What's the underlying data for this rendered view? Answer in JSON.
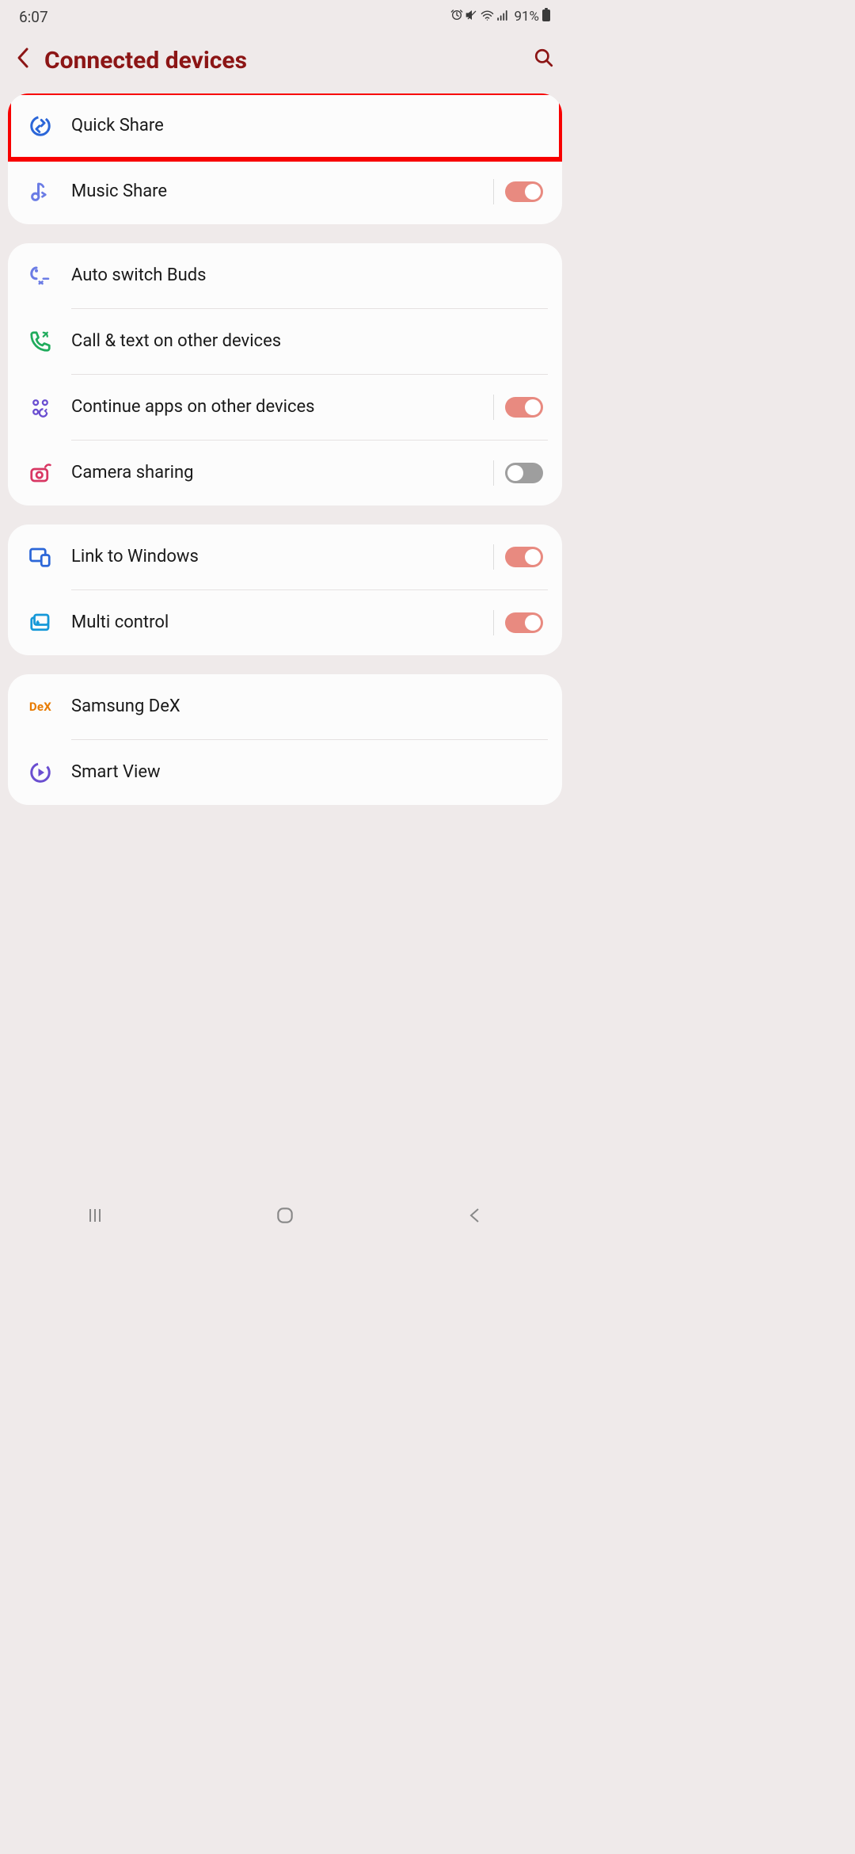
{
  "status": {
    "time": "6:07",
    "battery": "91%"
  },
  "header": {
    "title": "Connected devices"
  },
  "groups": [
    {
      "items": [
        {
          "id": "quick-share",
          "label": "Quick Share",
          "icon": "quick-share-icon",
          "icon_color": "#2b66d8",
          "highlighted": true
        },
        {
          "id": "music-share",
          "label": "Music Share",
          "icon": "music-share-icon",
          "icon_color": "#6b7ce5",
          "toggle": true
        }
      ]
    },
    {
      "items": [
        {
          "id": "auto-switch-buds",
          "label": "Auto switch Buds",
          "icon": "buds-icon",
          "icon_color": "#6b7ce5"
        },
        {
          "id": "call-text",
          "label": "Call & text on other devices",
          "icon": "phone-icon",
          "icon_color": "#1fab5c"
        },
        {
          "id": "continue-apps",
          "label": "Continue apps on other devices",
          "icon": "apps-icon",
          "icon_color": "#6a4ed0",
          "toggle": true
        },
        {
          "id": "camera-sharing",
          "label": "Camera sharing",
          "icon": "camera-icon",
          "icon_color": "#d83763",
          "toggle": false
        }
      ]
    },
    {
      "items": [
        {
          "id": "link-windows",
          "label": "Link to Windows",
          "icon": "windows-icon",
          "icon_color": "#2b66d8",
          "toggle": true
        },
        {
          "id": "multi-control",
          "label": "Multi control",
          "icon": "multi-control-icon",
          "icon_color": "#1598d8",
          "toggle": true
        }
      ]
    },
    {
      "items": [
        {
          "id": "samsung-dex",
          "label": "Samsung DeX",
          "icon": "dex-icon",
          "icon_text": "DeX"
        },
        {
          "id": "smart-view",
          "label": "Smart View",
          "icon": "smart-view-icon",
          "icon_color": "#6a4ed0"
        }
      ]
    }
  ]
}
